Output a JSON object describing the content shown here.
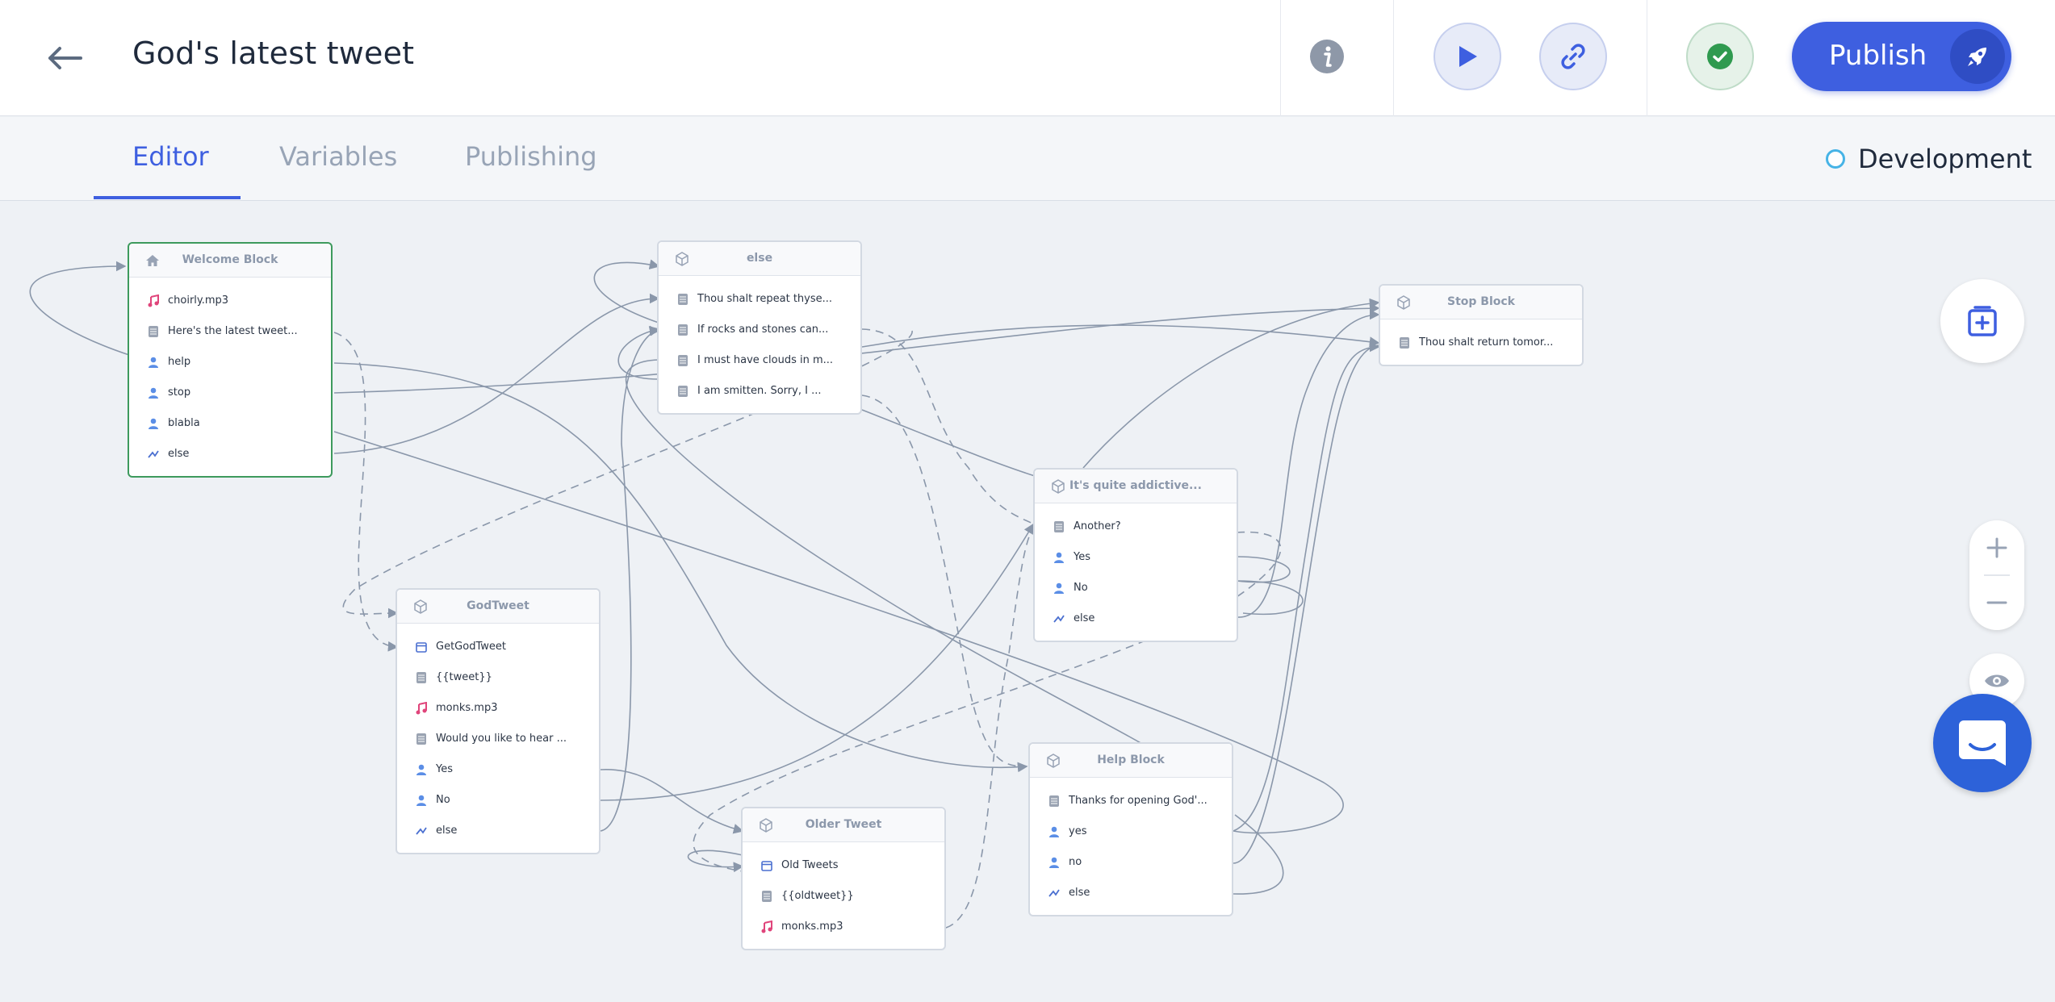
{
  "header": {
    "title": "God's latest tweet",
    "publish_label": "Publish"
  },
  "tabs": [
    {
      "label": "Editor",
      "active": true
    },
    {
      "label": "Variables",
      "active": false
    },
    {
      "label": "Publishing",
      "active": false
    }
  ],
  "environment": {
    "label": "Development"
  },
  "colors": {
    "accent": "#3e5fe0",
    "start_border": "#3d9a5d",
    "audio_icon": "#e0457b",
    "user_icon": "#5b8ee6"
  },
  "blocks": {
    "welcome": {
      "title": "Welcome Block",
      "icon": "home-icon",
      "items": [
        {
          "icon": "music-note-icon",
          "label": "choirly.mp3"
        },
        {
          "icon": "text-icon",
          "label": "Here's the latest tweet..."
        },
        {
          "icon": "user-icon",
          "label": "help"
        },
        {
          "icon": "user-icon",
          "label": "stop"
        },
        {
          "icon": "user-icon",
          "label": "blabla"
        },
        {
          "icon": "else-icon",
          "label": "else"
        }
      ]
    },
    "else": {
      "title": "else",
      "icon": "cube-icon",
      "items": [
        {
          "icon": "text-icon",
          "label": "Thou shalt repeat thyse..."
        },
        {
          "icon": "text-icon",
          "label": "If rocks and stones can..."
        },
        {
          "icon": "text-icon",
          "label": "I must have clouds in m..."
        },
        {
          "icon": "text-icon",
          "label": "I am smitten. Sorry, I ..."
        }
      ]
    },
    "stop": {
      "title": "Stop Block",
      "icon": "cube-icon",
      "items": [
        {
          "icon": "text-icon",
          "label": "Thou shalt return tomor..."
        }
      ]
    },
    "addictive": {
      "title": "It's quite addictive...",
      "icon": "cube-icon",
      "items": [
        {
          "icon": "text-icon",
          "label": "Another?"
        },
        {
          "icon": "user-icon",
          "label": "Yes"
        },
        {
          "icon": "user-icon",
          "label": "No"
        },
        {
          "icon": "else-icon",
          "label": "else"
        }
      ]
    },
    "godtweet": {
      "title": "GodTweet",
      "icon": "cube-icon",
      "items": [
        {
          "icon": "calendar-icon",
          "label": "GetGodTweet"
        },
        {
          "icon": "text-icon",
          "label": "{{tweet}}"
        },
        {
          "icon": "music-note-icon",
          "label": "monks.mp3"
        },
        {
          "icon": "text-icon",
          "label": "Would you like to hear ..."
        },
        {
          "icon": "user-icon",
          "label": "Yes"
        },
        {
          "icon": "user-icon",
          "label": "No"
        },
        {
          "icon": "else-icon",
          "label": "else"
        }
      ]
    },
    "older": {
      "title": "Older Tweet",
      "icon": "cube-icon",
      "items": [
        {
          "icon": "calendar-icon",
          "label": "Old Tweets"
        },
        {
          "icon": "text-icon",
          "label": "{{oldtweet}}"
        },
        {
          "icon": "music-note-icon",
          "label": "monks.mp3"
        }
      ]
    },
    "help": {
      "title": "Help Block",
      "icon": "cube-icon",
      "items": [
        {
          "icon": "text-icon",
          "label": "Thanks for opening God'..."
        },
        {
          "icon": "user-icon",
          "label": "yes"
        },
        {
          "icon": "user-icon",
          "label": "no"
        },
        {
          "icon": "else-icon",
          "label": "else"
        }
      ]
    }
  }
}
